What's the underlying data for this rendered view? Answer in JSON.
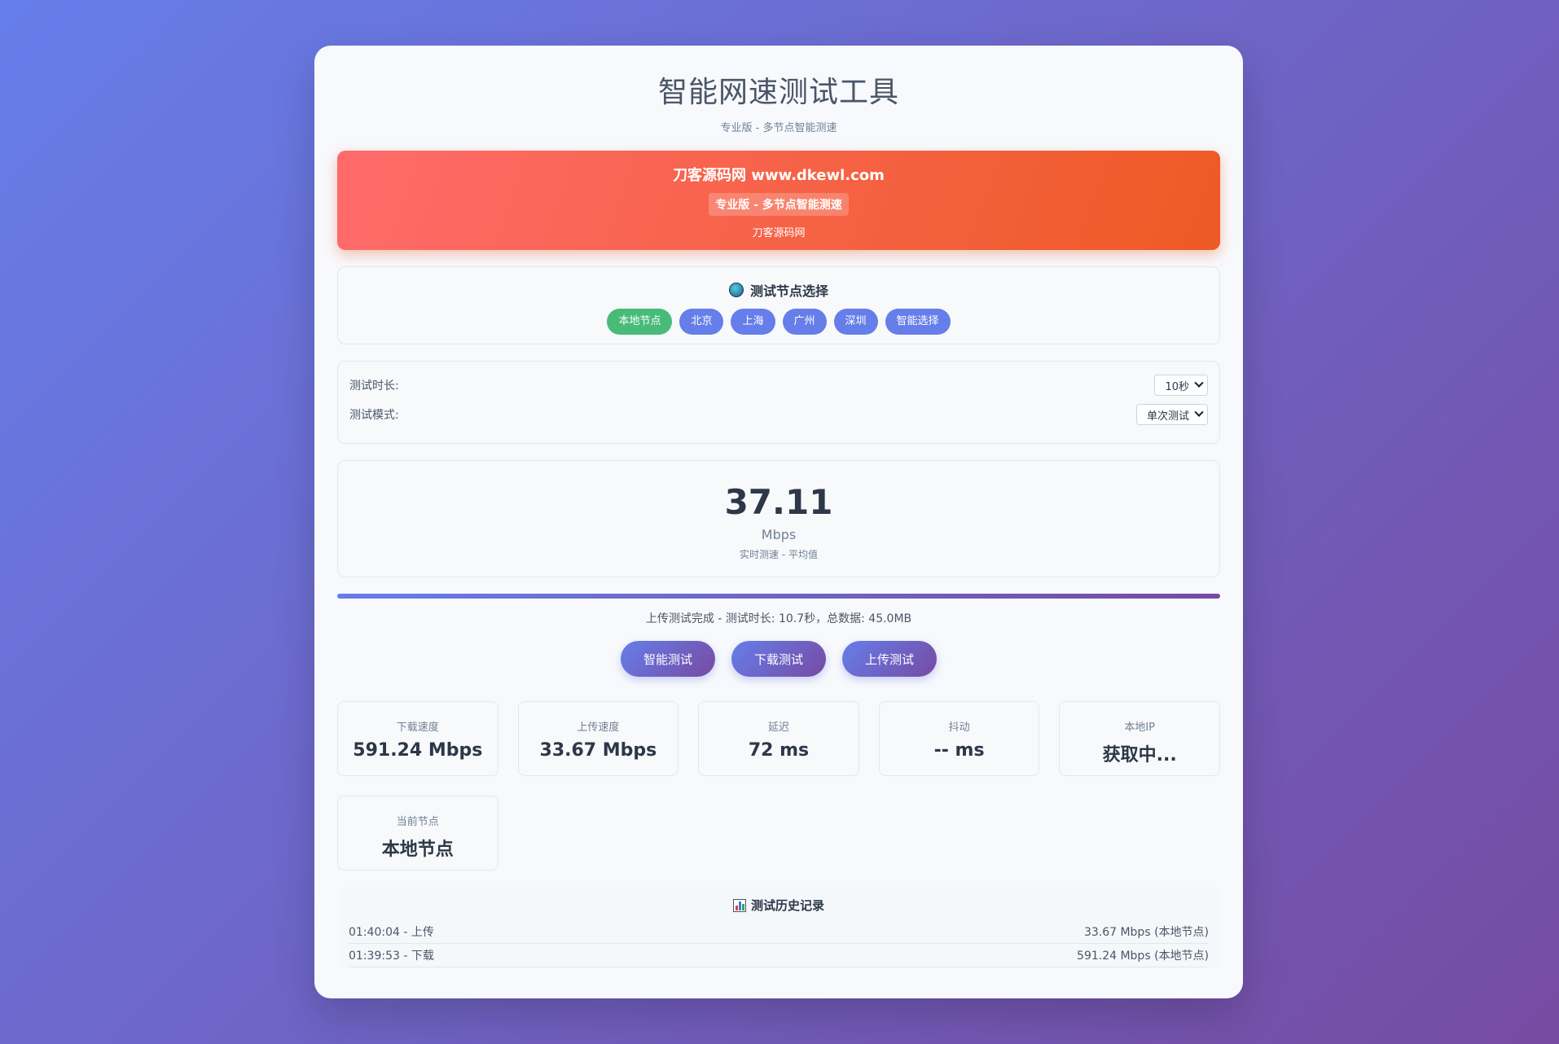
{
  "header": {
    "title": "智能网速测试工具",
    "subtitle": "专业版 - 多节点智能测速"
  },
  "banner": {
    "title": "刀客源码网 www.dkewl.com",
    "badge": "专业版 - 多节点智能测速",
    "footer": "刀客源码网"
  },
  "nodes": {
    "title": "测试节点选择",
    "icon": "globe-icon",
    "items": [
      "本地节点",
      "北京",
      "上海",
      "广州",
      "深圳",
      "智能选择"
    ],
    "active_index": 0,
    "active_color": "#48bb78",
    "inactive_color": "#667eea"
  },
  "settings": {
    "duration_label": "测试时长:",
    "duration_value": "10秒",
    "mode_label": "测试模式:",
    "mode_value": "单次测试"
  },
  "speed": {
    "value": "37.11",
    "unit": "Mbps",
    "note": "实时测速 - 平均值"
  },
  "progress": {
    "percent": 100
  },
  "status": "上传测试完成 - 测试时长: 10.7秒，总数据: 45.0MB",
  "actions": {
    "smart": "智能测试",
    "download": "下载测试",
    "upload": "上传测试"
  },
  "stats": [
    {
      "label": "下载速度",
      "value": "591.24 Mbps"
    },
    {
      "label": "上传速度",
      "value": "33.67 Mbps"
    },
    {
      "label": "延迟",
      "value": "72 ms"
    },
    {
      "label": "抖动",
      "value": "-- ms"
    },
    {
      "label": "本地IP",
      "value": "获取中..."
    },
    {
      "label": "当前节点",
      "value": "本地节点"
    }
  ],
  "history": {
    "title": "测试历史记录",
    "icon": "bar-chart-icon",
    "rows": [
      {
        "left": "01:40:04 - 上传",
        "right": "33.67 Mbps (本地节点)"
      },
      {
        "left": "01:39:53 - 下载",
        "right": "591.24 Mbps (本地节点)"
      }
    ]
  },
  "colors": {
    "bg_start": "#667eea",
    "bg_end": "#764ba2",
    "banner_start": "#ff6b6b",
    "banner_end": "#ee5a24"
  }
}
